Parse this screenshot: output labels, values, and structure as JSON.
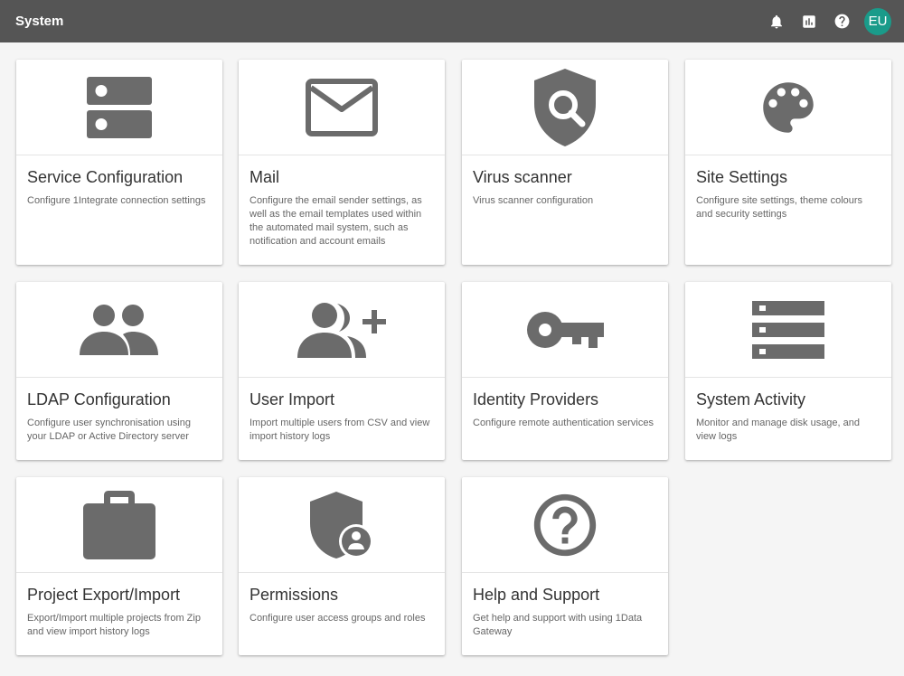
{
  "header": {
    "title": "System",
    "avatar_initials": "EU",
    "avatar_color": "#1a9b8a",
    "actions": [
      "bell-icon",
      "bar-chart-icon",
      "help-circle-icon"
    ]
  },
  "cards": [
    {
      "id": "service-configuration",
      "title": "Service Configuration",
      "description": "Configure 1Integrate connection settings",
      "icon": "server-icon"
    },
    {
      "id": "mail",
      "title": "Mail",
      "description": "Configure the email sender settings, as well as the email templates used within the automated mail system, such as notification and account emails",
      "icon": "mail-icon"
    },
    {
      "id": "virus-scanner",
      "title": "Virus scanner",
      "description": "Virus scanner configuration",
      "icon": "shield-search-icon"
    },
    {
      "id": "site-settings",
      "title": "Site Settings",
      "description": "Configure site settings, theme colours and security settings",
      "icon": "palette-icon"
    },
    {
      "id": "ldap-configuration",
      "title": "LDAP Configuration",
      "description": "Configure user synchronisation using your LDAP or Active Directory server",
      "icon": "people-icon"
    },
    {
      "id": "user-import",
      "title": "User Import",
      "description": "Import multiple users from CSV and view import history logs",
      "icon": "group-add-icon"
    },
    {
      "id": "identity-providers",
      "title": "Identity Providers",
      "description": "Configure remote authentication services",
      "icon": "key-icon"
    },
    {
      "id": "system-activity",
      "title": "System Activity",
      "description": "Monitor and manage disk usage, and view logs",
      "icon": "storage-list-icon"
    },
    {
      "id": "project-export-import",
      "title": "Project Export/Import",
      "description": "Export/Import multiple projects from Zip and view import history logs",
      "icon": "briefcase-icon"
    },
    {
      "id": "permissions",
      "title": "Permissions",
      "description": "Configure user access groups and roles",
      "icon": "admin-shield-icon"
    },
    {
      "id": "help-and-support",
      "title": "Help and Support",
      "description": "Get help and support with using 1Data Gateway",
      "icon": "help-outline-icon"
    }
  ],
  "icon_color": "#6b6b6b"
}
